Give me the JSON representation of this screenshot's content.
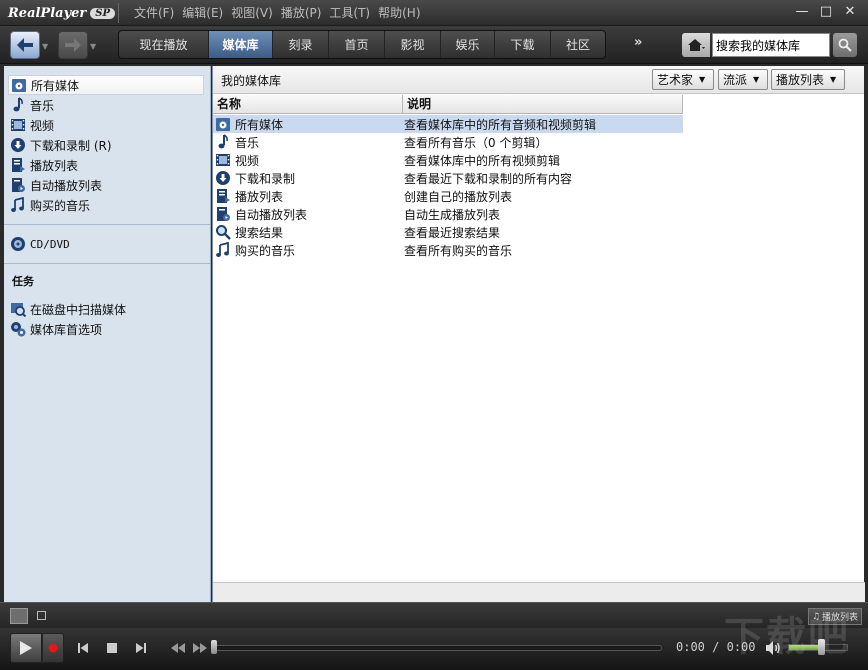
{
  "app": {
    "logo_text": "RealPlayer",
    "logo_badge": "SP",
    "menu": [
      "文件(F)",
      "编辑(E)",
      "视图(V)",
      "播放(P)",
      "工具(T)",
      "帮助(H)"
    ],
    "window_buttons": {
      "minimize": "—",
      "restore": "□",
      "close": "✕"
    }
  },
  "nav": {
    "tabs": [
      "现在播放",
      "媒体库",
      "刻录",
      "首页",
      "影视",
      "娱乐",
      "下载",
      "社区"
    ],
    "active_tab_index": 1,
    "more_label": "»",
    "search_value": "搜索我的媒体库"
  },
  "sidebar": {
    "items": [
      {
        "label": "所有媒体",
        "icon": "all-media-icon",
        "selected": true
      },
      {
        "label": "音乐",
        "icon": "music-note-icon"
      },
      {
        "label": "视频",
        "icon": "video-film-icon"
      },
      {
        "label": "下载和录制 (R)",
        "icon": "download-icon"
      },
      {
        "label": "播放列表",
        "icon": "playlist-icon"
      },
      {
        "label": "自动播放列表",
        "icon": "auto-playlist-icon"
      },
      {
        "label": "购买的音乐",
        "icon": "purchased-music-icon"
      }
    ],
    "cd_item": "CD/DVD",
    "tasks_heading": "任务",
    "tasks": [
      {
        "label": "在磁盘中扫描媒体",
        "icon": "scan-disk-icon"
      },
      {
        "label": "媒体库首选项",
        "icon": "preferences-icon"
      }
    ]
  },
  "main": {
    "title": "我的媒体库",
    "filters": [
      "艺术家",
      "流派",
      "播放列表"
    ],
    "columns": [
      "名称",
      "说明"
    ],
    "rows": [
      {
        "name": "所有媒体",
        "desc": "查看媒体库中的所有音频和视频剪辑",
        "icon": "all-media-icon",
        "selected": true
      },
      {
        "name": "音乐",
        "desc": "查看所有音乐（0 个剪辑）",
        "icon": "music-note-icon"
      },
      {
        "name": "视频",
        "desc": "查看媒体库中的所有视频剪辑",
        "icon": "video-film-icon"
      },
      {
        "name": "下载和录制",
        "desc": "查看最近下载和录制的所有内容",
        "icon": "download-icon"
      },
      {
        "name": "播放列表",
        "desc": "创建自己的播放列表",
        "icon": "playlist-icon"
      },
      {
        "name": "自动播放列表",
        "desc": "自动生成播放列表",
        "icon": "auto-playlist-icon"
      },
      {
        "name": "搜索结果",
        "desc": "查看最近搜索结果",
        "icon": "search-icon"
      },
      {
        "name": "购买的音乐",
        "desc": "查看所有购买的音乐",
        "icon": "purchased-music-icon"
      }
    ]
  },
  "status": {
    "playlist_button": "播放列表"
  },
  "transport": {
    "time_current": "0:00",
    "time_separator": "/",
    "time_total": "0:00",
    "seek_fraction": 0.0,
    "volume_fraction": 0.55
  },
  "watermark": "下载吧",
  "colors": {
    "accent": "#3b5c87",
    "selection": "#c9daf0",
    "sidebar_bg": "#d9e3ee",
    "record_red": "#e01818"
  }
}
